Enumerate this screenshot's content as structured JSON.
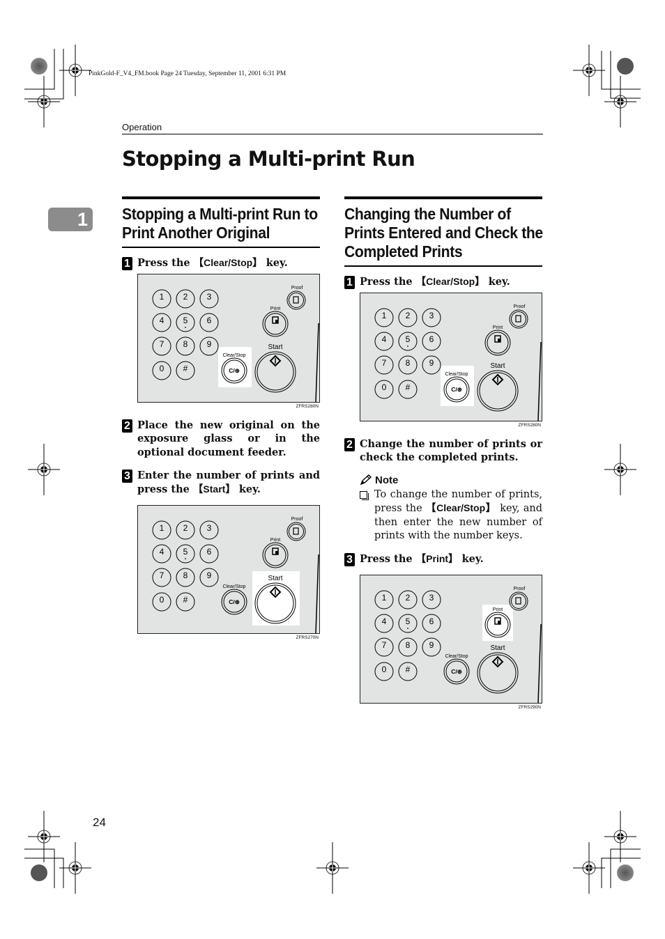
{
  "print_meta": "PinkGold-F_V4_FM.book  Page 24  Tuesday, September 11, 2001  6:31 PM",
  "running_head": "Operation",
  "page_title": "Stopping a Multi-print Run",
  "chapter_tab": "1",
  "page_number": "24",
  "panel_labels": {
    "keys": [
      "1",
      "2",
      "3",
      "4",
      "5",
      "6",
      "7",
      "8",
      "9",
      "0",
      "#"
    ],
    "proof": "Proof",
    "print": "Print",
    "start": "Start",
    "clear_stop": "Clear/Stop",
    "clear_stop_key": "C/⊛"
  },
  "left_section": {
    "title_line1": "Stopping a Multi-print Run to",
    "title_line2": "Print Another Original",
    "steps": [
      {
        "num": "1",
        "pre": "Press the ",
        "key": "Clear/Stop",
        "post": " key."
      },
      {
        "num": "2",
        "text": "Place the new original on the exposure glass or in the optional document feeder."
      },
      {
        "num": "3",
        "pre": "Enter the number of prints and press the ",
        "key": "Start",
        "post": " key."
      }
    ],
    "figures": [
      {
        "code": "ZFRS280N",
        "highlight": "clear_stop"
      },
      {
        "code": "ZFRS270N",
        "highlight": "start"
      }
    ]
  },
  "right_section": {
    "title_line1": "Changing the Number of",
    "title_line2": "Prints Entered and Check the",
    "title_line3": "Completed Prints",
    "steps": [
      {
        "num": "1",
        "pre": "Press the ",
        "key": "Clear/Stop",
        "post": " key."
      },
      {
        "num": "2",
        "text": "Change the number of prints or check the completed prints."
      },
      {
        "num": "3",
        "pre": "Press the ",
        "key": "Print",
        "post": " key."
      }
    ],
    "note": {
      "title": "Note",
      "pre": "To change the number of prints, press the ",
      "key": "Clear/Stop",
      "post": " key, and then enter the new number of prints with the number keys."
    },
    "figures": [
      {
        "code": "ZFRS280N",
        "highlight": "clear_stop"
      },
      {
        "code": "ZFRS290N",
        "highlight": "print"
      }
    ]
  }
}
